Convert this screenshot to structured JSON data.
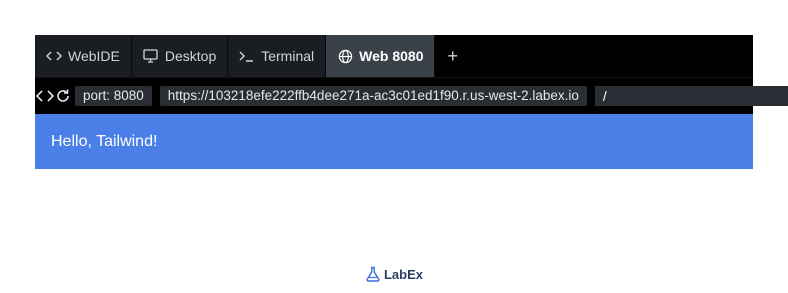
{
  "tabs": [
    {
      "label": "WebIDE",
      "icon": "code-icon",
      "active": false
    },
    {
      "label": "Desktop",
      "icon": "monitor-icon",
      "active": false
    },
    {
      "label": "Terminal",
      "icon": "terminal-icon",
      "active": false
    },
    {
      "label": "Web 8080",
      "icon": "globe-icon",
      "active": true
    }
  ],
  "add_tab_label": "+",
  "navbar": {
    "port_label": "port: 8080",
    "url": "https://103218efe222ffb4dee271a-ac3c01ed1f90.r.us-west-2.labex.io",
    "path": "/"
  },
  "page": {
    "banner_text": "Hello, Tailwind!",
    "banner_color": "#4b7fe8"
  },
  "footer": {
    "brand": "LabEx",
    "logo_icon": "flask-icon"
  }
}
